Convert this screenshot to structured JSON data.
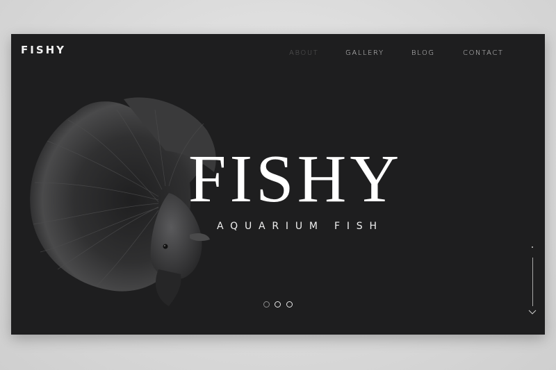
{
  "brand": {
    "logo_text": "FISHY"
  },
  "nav": {
    "items": [
      {
        "label": "ABOUT",
        "active": true
      },
      {
        "label": "GALLERY",
        "active": false
      },
      {
        "label": "BLOG",
        "active": false
      },
      {
        "label": "CONTACT",
        "active": false
      }
    ]
  },
  "hero": {
    "title": "FISHY",
    "subtitle": "AQUARIUM FISH"
  },
  "slider": {
    "slide_count": 3,
    "current_slide": 2
  },
  "colors": {
    "background": "#1e1e1f",
    "text": "#ffffff",
    "nav_inactive": "#d6d6d6",
    "nav_active": "#5d5d5d"
  },
  "icons": {
    "scroll": "chevron-down-icon",
    "hero_image": "betta-fish-image"
  }
}
